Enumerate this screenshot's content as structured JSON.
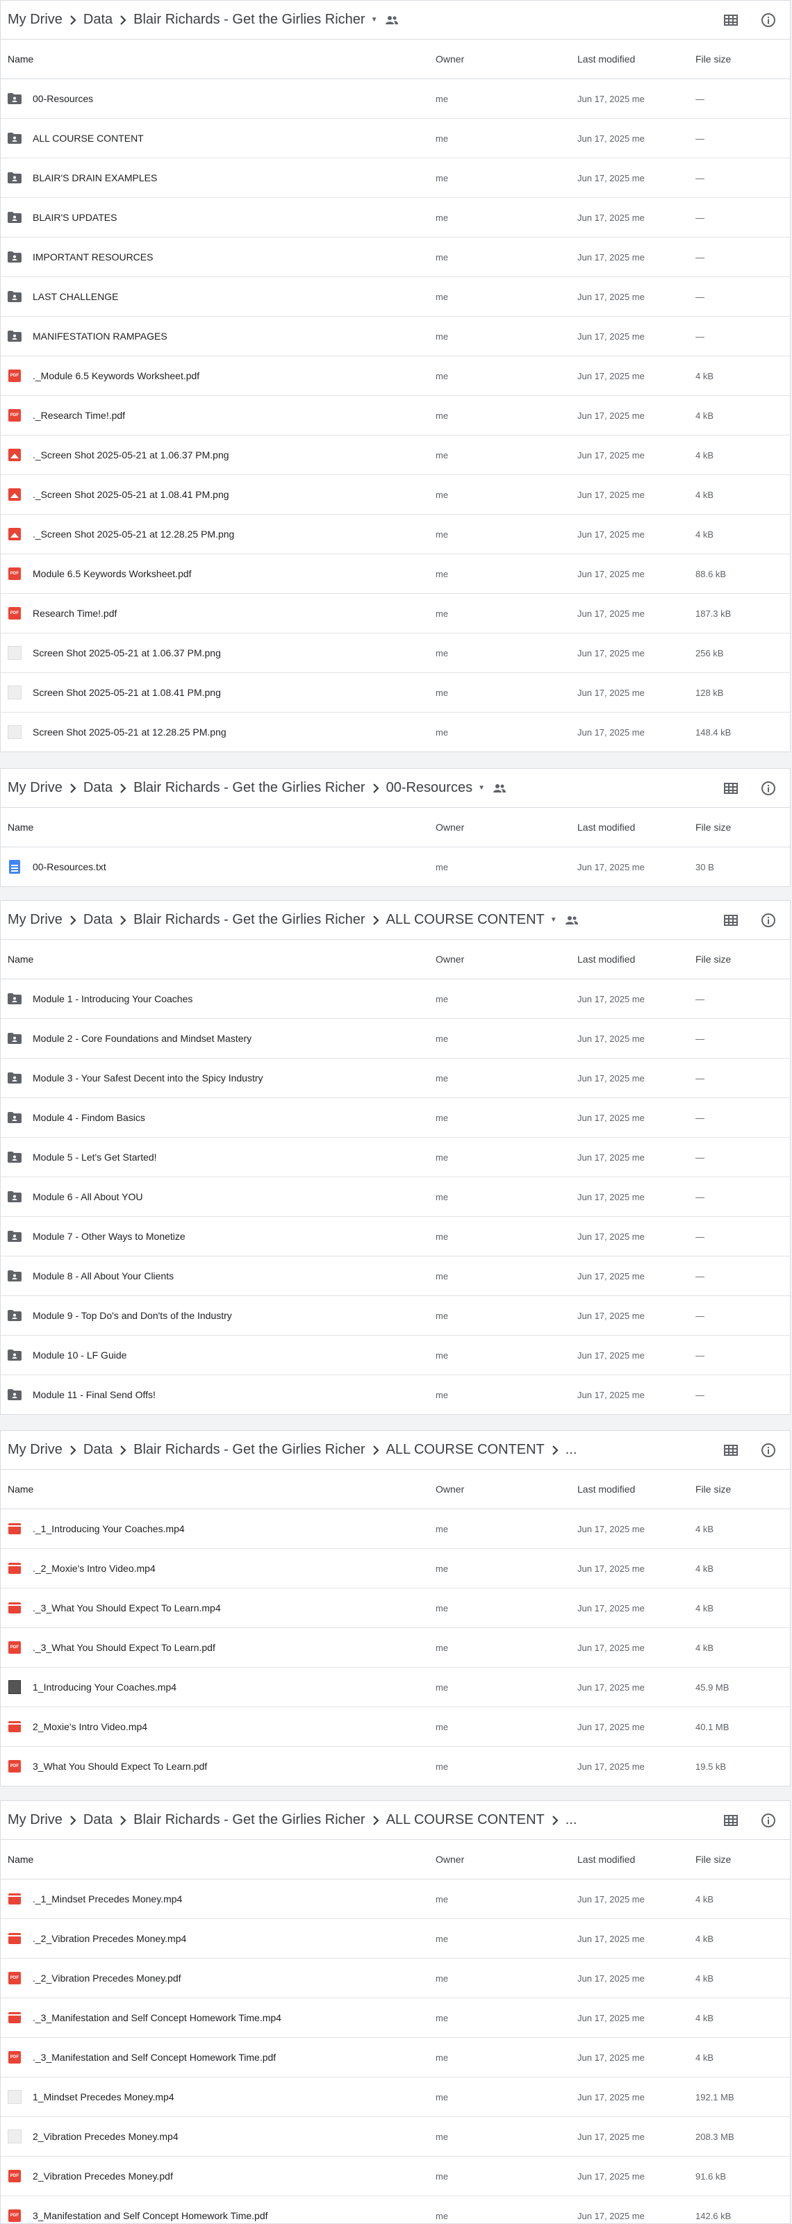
{
  "headers": {
    "name": "Name",
    "owner": "Owner",
    "modified": "Last modified",
    "size": "File size"
  },
  "panels": [
    {
      "crumbs": [
        "My Drive",
        "Data",
        "Blair Richards - Get the Girlies Richer"
      ],
      "has_dropdown": true,
      "has_shared": true,
      "rows": [
        {
          "icon": "folder",
          "name": "00-Resources",
          "owner": "me",
          "modified": "Jun 17, 2025 me",
          "size": "—"
        },
        {
          "icon": "folder",
          "name": "ALL COURSE CONTENT",
          "owner": "me",
          "modified": "Jun 17, 2025 me",
          "size": "—"
        },
        {
          "icon": "folder",
          "name": "BLAIR'S DRAIN EXAMPLES",
          "owner": "me",
          "modified": "Jun 17, 2025 me",
          "size": "—"
        },
        {
          "icon": "folder",
          "name": "BLAIR'S UPDATES",
          "owner": "me",
          "modified": "Jun 17, 2025 me",
          "size": "—"
        },
        {
          "icon": "folder",
          "name": "IMPORTANT RESOURCES",
          "owner": "me",
          "modified": "Jun 17, 2025 me",
          "size": "—"
        },
        {
          "icon": "folder",
          "name": "LAST CHALLENGE",
          "owner": "me",
          "modified": "Jun 17, 2025 me",
          "size": "—"
        },
        {
          "icon": "folder",
          "name": "MANIFESTATION RAMPAGES",
          "owner": "me",
          "modified": "Jun 17, 2025 me",
          "size": "—"
        },
        {
          "icon": "pdf",
          "name": "._Module 6.5 Keywords Worksheet.pdf",
          "owner": "me",
          "modified": "Jun 17, 2025 me",
          "size": "4 kB"
        },
        {
          "icon": "pdf",
          "name": "._Research Time!.pdf",
          "owner": "me",
          "modified": "Jun 17, 2025 me",
          "size": "4 kB"
        },
        {
          "icon": "image",
          "name": "._Screen Shot 2025-05-21 at 1.06.37 PM.png",
          "owner": "me",
          "modified": "Jun 17, 2025 me",
          "size": "4 kB"
        },
        {
          "icon": "image",
          "name": "._Screen Shot 2025-05-21 at 1.08.41 PM.png",
          "owner": "me",
          "modified": "Jun 17, 2025 me",
          "size": "4 kB"
        },
        {
          "icon": "image",
          "name": "._Screen Shot 2025-05-21 at 12.28.25 PM.png",
          "owner": "me",
          "modified": "Jun 17, 2025 me",
          "size": "4 kB"
        },
        {
          "icon": "pdf",
          "name": "Module 6.5 Keywords Worksheet.pdf",
          "owner": "me",
          "modified": "Jun 17, 2025 me",
          "size": "88.6 kB"
        },
        {
          "icon": "pdf",
          "name": "Research Time!.pdf",
          "owner": "me",
          "modified": "Jun 17, 2025 me",
          "size": "187.3 kB"
        },
        {
          "icon": "thumb",
          "name": "Screen Shot 2025-05-21 at 1.06.37 PM.png",
          "owner": "me",
          "modified": "Jun 17, 2025 me",
          "size": "256 kB"
        },
        {
          "icon": "thumb",
          "name": "Screen Shot 2025-05-21 at 1.08.41 PM.png",
          "owner": "me",
          "modified": "Jun 17, 2025 me",
          "size": "128 kB"
        },
        {
          "icon": "thumb",
          "name": "Screen Shot 2025-05-21 at 12.28.25 PM.png",
          "owner": "me",
          "modified": "Jun 17, 2025 me",
          "size": "148.4 kB"
        }
      ]
    },
    {
      "crumbs": [
        "My Drive",
        "Data",
        "Blair Richards - Get the Girlies Richer",
        "00-Resources"
      ],
      "has_dropdown": true,
      "has_shared": true,
      "rows": [
        {
          "icon": "doc",
          "name": "00-Resources.txt",
          "owner": "me",
          "modified": "Jun 17, 2025 me",
          "size": "30 B"
        }
      ]
    },
    {
      "crumbs": [
        "My Drive",
        "Data",
        "Blair Richards - Get the Girlies Richer",
        "ALL COURSE CONTENT"
      ],
      "has_dropdown": true,
      "has_shared": true,
      "rows": [
        {
          "icon": "folder",
          "name": "Module 1 - Introducing Your Coaches",
          "owner": "me",
          "modified": "Jun 17, 2025 me",
          "size": "—"
        },
        {
          "icon": "folder",
          "name": "Module 2 - Core Foundations and Mindset Mastery",
          "owner": "me",
          "modified": "Jun 17, 2025 me",
          "size": "—"
        },
        {
          "icon": "folder",
          "name": "Module 3 - Your Safest Decent into the Spicy Industry",
          "owner": "me",
          "modified": "Jun 17, 2025 me",
          "size": "—"
        },
        {
          "icon": "folder",
          "name": "Module 4 - Findom Basics",
          "owner": "me",
          "modified": "Jun 17, 2025 me",
          "size": "—"
        },
        {
          "icon": "folder",
          "name": "Module 5 - Let's Get Started!",
          "owner": "me",
          "modified": "Jun 17, 2025 me",
          "size": "—"
        },
        {
          "icon": "folder",
          "name": "Module 6 - All About YOU",
          "owner": "me",
          "modified": "Jun 17, 2025 me",
          "size": "—"
        },
        {
          "icon": "folder",
          "name": "Module 7 - Other Ways to Monetize",
          "owner": "me",
          "modified": "Jun 17, 2025 me",
          "size": "—"
        },
        {
          "icon": "folder",
          "name": "Module 8 - All About Your Clients",
          "owner": "me",
          "modified": "Jun 17, 2025 me",
          "size": "—"
        },
        {
          "icon": "folder",
          "name": "Module 9 - Top Do's and Don'ts of the Industry",
          "owner": "me",
          "modified": "Jun 17, 2025 me",
          "size": "—"
        },
        {
          "icon": "folder",
          "name": "Module 10 - LF Guide",
          "owner": "me",
          "modified": "Jun 17, 2025 me",
          "size": "—"
        },
        {
          "icon": "folder",
          "name": "Module 11 - Final Send Offs!",
          "owner": "me",
          "modified": "Jun 17, 2025 me",
          "size": "—"
        }
      ]
    },
    {
      "crumbs": [
        "My Drive",
        "Data",
        "Blair Richards - Get the Girlies Richer",
        "ALL COURSE CONTENT",
        "..."
      ],
      "has_dropdown": false,
      "has_shared": false,
      "rows": [
        {
          "icon": "video",
          "name": "._1_Introducing Your Coaches.mp4",
          "owner": "me",
          "modified": "Jun 17, 2025 me",
          "size": "4 kB"
        },
        {
          "icon": "video",
          "name": "._2_Moxie's Intro Video.mp4",
          "owner": "me",
          "modified": "Jun 17, 2025 me",
          "size": "4 kB"
        },
        {
          "icon": "video",
          "name": "._3_What You Should Expect To Learn.mp4",
          "owner": "me",
          "modified": "Jun 17, 2025 me",
          "size": "4 kB"
        },
        {
          "icon": "pdf",
          "name": "._3_What You Should Expect To Learn.pdf",
          "owner": "me",
          "modified": "Jun 17, 2025 me",
          "size": "4 kB"
        },
        {
          "icon": "thumbdark",
          "name": "1_Introducing Your Coaches.mp4",
          "owner": "me",
          "modified": "Jun 17, 2025 me",
          "size": "45.9 MB"
        },
        {
          "icon": "video",
          "name": "2_Moxie's Intro Video.mp4",
          "owner": "me",
          "modified": "Jun 17, 2025 me",
          "size": "40.1 MB"
        },
        {
          "icon": "pdf",
          "name": "3_What You Should Expect To Learn.pdf",
          "owner": "me",
          "modified": "Jun 17, 2025 me",
          "size": "19.5 kB"
        }
      ]
    },
    {
      "crumbs": [
        "My Drive",
        "Data",
        "Blair Richards - Get the Girlies Richer",
        "ALL COURSE CONTENT",
        "..."
      ],
      "has_dropdown": false,
      "has_shared": false,
      "rows": [
        {
          "icon": "video",
          "name": "._1_Mindset Precedes Money.mp4",
          "owner": "me",
          "modified": "Jun 17, 2025 me",
          "size": "4 kB"
        },
        {
          "icon": "video",
          "name": "._2_Vibration Precedes Money.mp4",
          "owner": "me",
          "modified": "Jun 17, 2025 me",
          "size": "4 kB"
        },
        {
          "icon": "pdf",
          "name": "._2_Vibration Precedes Money.pdf",
          "owner": "me",
          "modified": "Jun 17, 2025 me",
          "size": "4 kB"
        },
        {
          "icon": "video",
          "name": "._3_Manifestation and Self Concept Homework Time.mp4",
          "owner": "me",
          "modified": "Jun 17, 2025 me",
          "size": "4 kB"
        },
        {
          "icon": "pdf",
          "name": "._3_Manifestation and Self Concept Homework Time.pdf",
          "owner": "me",
          "modified": "Jun 17, 2025 me",
          "size": "4 kB"
        },
        {
          "icon": "thumb",
          "name": "1_Mindset Precedes Money.mp4",
          "owner": "me",
          "modified": "Jun 17, 2025 me",
          "size": "192.1 MB"
        },
        {
          "icon": "thumb",
          "name": "2_Vibration Precedes Money.mp4",
          "owner": "me",
          "modified": "Jun 17, 2025 me",
          "size": "208.3 MB"
        },
        {
          "icon": "pdf",
          "name": "2_Vibration Precedes Money.pdf",
          "owner": "me",
          "modified": "Jun 17, 2025 me",
          "size": "91.6 kB"
        },
        {
          "icon": "pdf",
          "name": "3_Manifestation and Self Concept Homework Time.pdf",
          "owner": "me",
          "modified": "Jun 17, 2025 me",
          "size": "142.6 kB"
        }
      ]
    }
  ]
}
